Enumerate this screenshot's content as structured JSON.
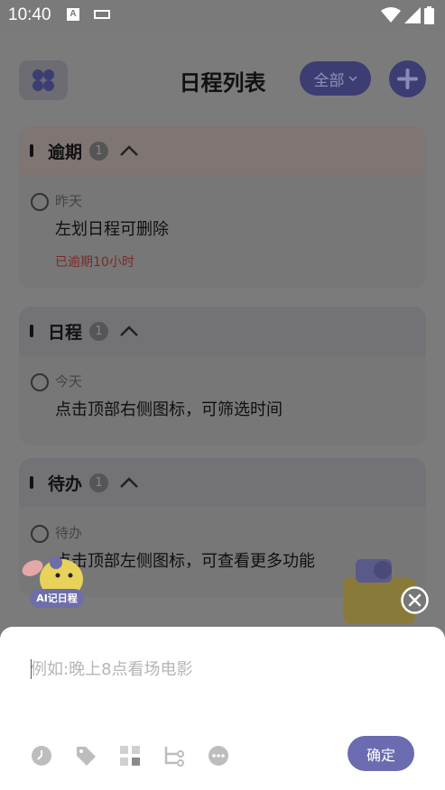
{
  "status_bar": {
    "time": "10:40",
    "icon_a": "A"
  },
  "header": {
    "title": "日程列表",
    "filter_label": "全部"
  },
  "sections": [
    {
      "label": "逾期",
      "count": "1",
      "item": {
        "date": "昨天",
        "title": "左划日程可删除",
        "note": "已逾期10小时"
      }
    },
    {
      "label": "日程",
      "count": "1",
      "item": {
        "date": "今天",
        "title": "点击顶部右侧图标，可筛选时间"
      }
    },
    {
      "label": "待办",
      "count": "1",
      "item": {
        "date": "待办",
        "title": "点击顶部左侧图标，可查看更多功能"
      }
    }
  ],
  "mascot": {
    "label": "AI记日程"
  },
  "sheet": {
    "placeholder": "例如:晚上8点看场电影",
    "value": "",
    "confirm_label": "确定"
  },
  "icons": [
    "clock-icon",
    "tag-icon",
    "grid-icon",
    "subtask-icon",
    "more-icon"
  ],
  "colors": {
    "accent": "#6a6bb0",
    "overdue": "#d05050"
  }
}
